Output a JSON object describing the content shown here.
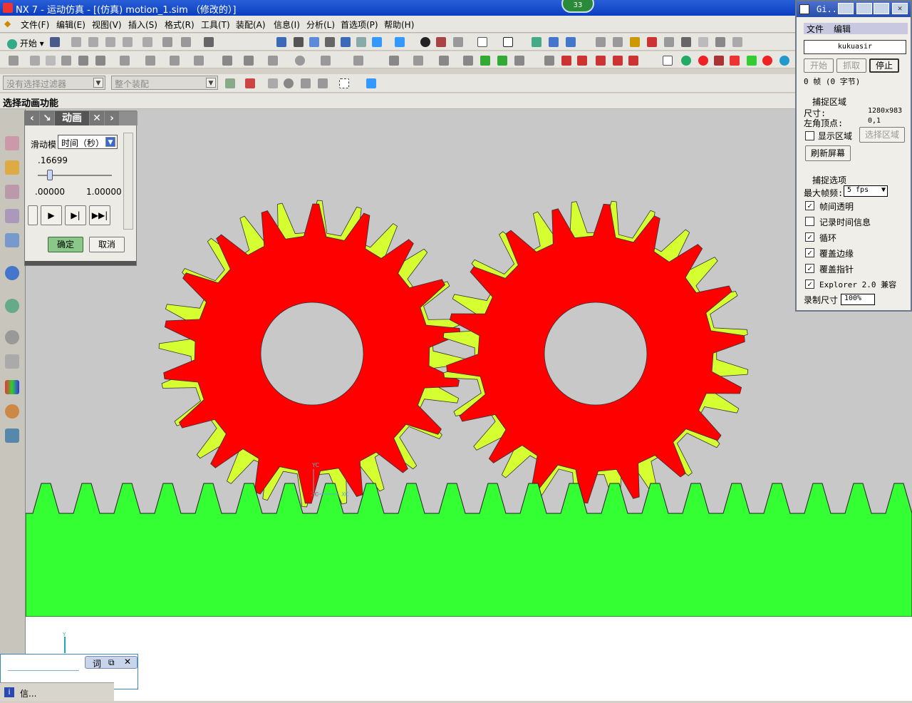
{
  "window": {
    "title": "NX 7 - 运动仿真 - [(仿真) motion_1.sim （修改的）]",
    "badge": "33"
  },
  "menu": [
    "文件(F)",
    "编辑(E)",
    "视图(V)",
    "插入(S)",
    "格式(R)",
    "工具(T)",
    "装配(A)",
    "信息(I)",
    "分析(L)",
    "首选项(P)",
    "帮助(H)"
  ],
  "toolbar": {
    "start_label": "开始",
    "filter_placeholder": "没有选择过滤器",
    "assembly_placeholder": "整个装配"
  },
  "cue": "选择动画功能",
  "dialog": {
    "title": "动画",
    "slider_label": "滑动模式",
    "mode": "时间（秒）",
    "current": ".16699",
    "min": ".00000",
    "max": "1.00000",
    "ok": "确定",
    "cancel": "取消"
  },
  "gif": {
    "title": "Gi...",
    "menu_file": "文件",
    "menu_edit": "编辑",
    "author": "kukuasir",
    "btn_start": "开始",
    "btn_grab": "抓取",
    "btn_stop": "停止",
    "frames": "0 帧 (0 字节)",
    "section_capture": "捕捉区域",
    "size_label": "尺寸:",
    "size_value": "1280x983",
    "corner_label": "左角顶点:",
    "corner_value": "0,1",
    "show_area": "显示区域",
    "select_area": "选择区域",
    "refresh": "刷新屏幕",
    "section_options": "捕捉选项",
    "fps_label": "最大帧频:",
    "fps_value": "5 fps",
    "opt_transparent": "帧间透明",
    "opt_record_time": "记录时间信息",
    "opt_loop": "循环",
    "opt_cover_edge": "覆盖边缘",
    "opt_cover_pointer": "覆盖指针",
    "opt_explorer": "Explorer 2.0 兼容",
    "record_size_label": "录制尺寸",
    "record_size_value": "100%"
  },
  "axes": {
    "yc": "YC",
    "xc": "XC",
    "zc": "ZC",
    "y": "Y"
  },
  "bottom": {
    "word": "词",
    "info": "信..."
  },
  "colors": {
    "gear_red": "#ff0000",
    "gear_yellow": "#d6ff32",
    "rack_green": "#33ff33",
    "bg": "#c8c8c8"
  }
}
